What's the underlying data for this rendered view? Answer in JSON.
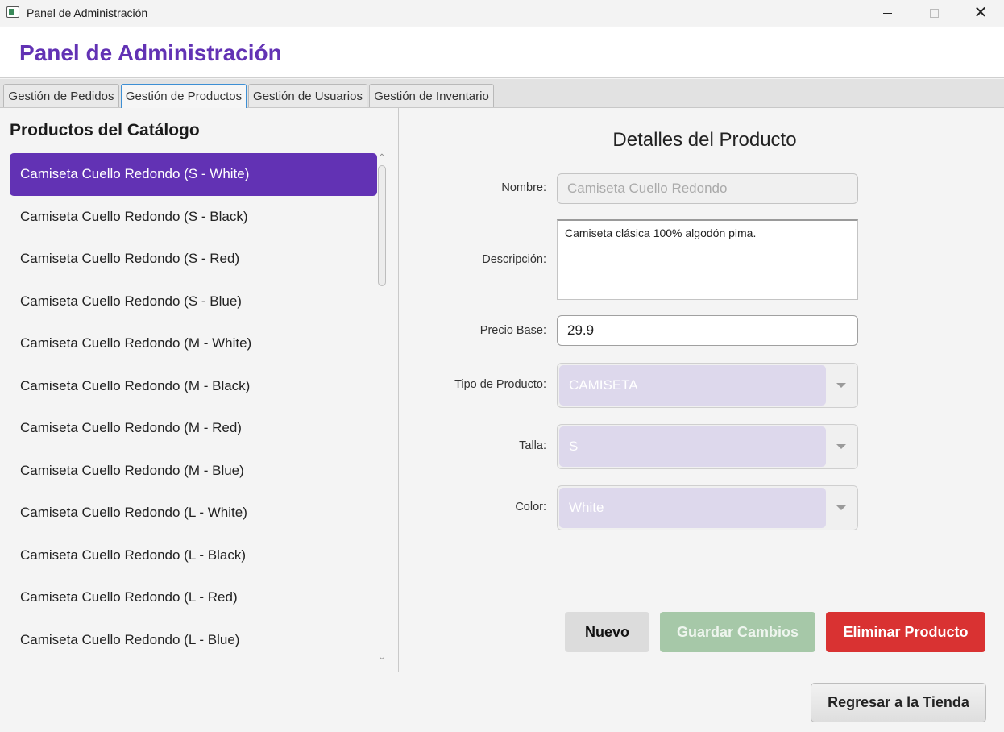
{
  "window": {
    "title": "Panel de Administración"
  },
  "header": {
    "title": "Panel de Administración"
  },
  "tabs": [
    {
      "label": "Gestión de Pedidos"
    },
    {
      "label": "Gestión de Productos"
    },
    {
      "label": "Gestión de Usuarios"
    },
    {
      "label": "Gestión de Inventario"
    }
  ],
  "active_tab": "Gestión de Productos",
  "catalog": {
    "title": "Productos del Catálogo",
    "items": [
      "Camiseta Cuello Redondo (S - White)",
      "Camiseta Cuello Redondo (S - Black)",
      "Camiseta Cuello Redondo (S - Red)",
      "Camiseta Cuello Redondo (S - Blue)",
      "Camiseta Cuello Redondo (M - White)",
      "Camiseta Cuello Redondo (M - Black)",
      "Camiseta Cuello Redondo (M - Red)",
      "Camiseta Cuello Redondo (M - Blue)",
      "Camiseta Cuello Redondo (L - White)",
      "Camiseta Cuello Redondo (L - Black)",
      "Camiseta Cuello Redondo (L - Red)",
      "Camiseta Cuello Redondo (L - Blue)"
    ],
    "selected": "Camiseta Cuello Redondo (S - White)"
  },
  "details": {
    "title": "Detalles del Producto",
    "labels": {
      "name": "Nombre:",
      "description": "Descripción:",
      "price": "Precio Base:",
      "type": "Tipo de Producto:",
      "size": "Talla:",
      "color": "Color:"
    },
    "name_value": "Camiseta Cuello Redondo",
    "description_value": "Camiseta clásica 100% algodón pima.",
    "price_value": "29.9",
    "type_value": "CAMISETA",
    "size_value": "S",
    "color_value": "White"
  },
  "buttons": {
    "new": "Nuevo",
    "save": "Guardar Cambios",
    "delete": "Eliminar Producto",
    "back": "Regresar a la Tienda"
  },
  "colors": {
    "accent": "#6232b4",
    "delete": "#d93232",
    "save_disabled": "#a6c8a8",
    "combo_disabled": "#ddd8ec"
  }
}
